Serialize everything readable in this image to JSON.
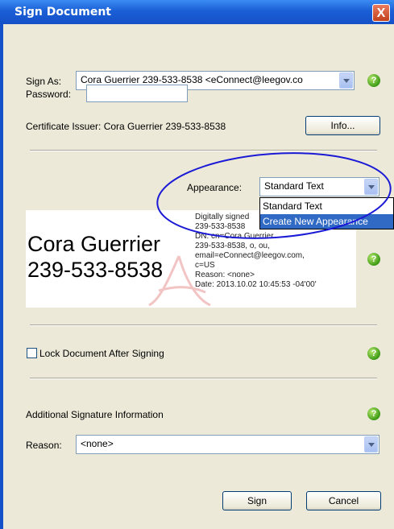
{
  "window": {
    "title": "Sign Document",
    "close_glyph": "X"
  },
  "sign_as": {
    "label": "Sign As:",
    "value": "Cora Guerrier 239-533-8538 <eConnect@leegov.co"
  },
  "password": {
    "label": "Password:",
    "value": ""
  },
  "certificate": {
    "text": "Certificate Issuer: Cora Guerrier 239-533-8538",
    "info_button": "Info..."
  },
  "appearance": {
    "label": "Appearance:",
    "value": "Standard Text",
    "options": [
      "Standard Text",
      "Create New Appearance"
    ],
    "highlighted": "Create New Appearance",
    "annotation_color": "#1a1ad6"
  },
  "preview": {
    "name_line1": "Cora Guerrier",
    "name_line2": "239-533-8538",
    "details": [
      "Digitally signed",
      "239-533-8538",
      "DN: cn=Cora Guerrier",
      "239-533-8538, o, ou,",
      "email=eConnect@leegov.com,",
      "c=US",
      "Reason: <none>",
      "Date: 2013.10.02 10:45:53 -04'00'"
    ]
  },
  "lock": {
    "label": "Lock Document After Signing",
    "checked": false
  },
  "additional": {
    "label": "Additional Signature Information"
  },
  "reason": {
    "label": "Reason:",
    "value": "<none>"
  },
  "buttons": {
    "sign": "Sign",
    "cancel": "Cancel"
  },
  "help_glyph": "?",
  "colors": {
    "titlebar": "#1b5fd6",
    "selection": "#316ac5",
    "help_green": "#3c9a15"
  }
}
